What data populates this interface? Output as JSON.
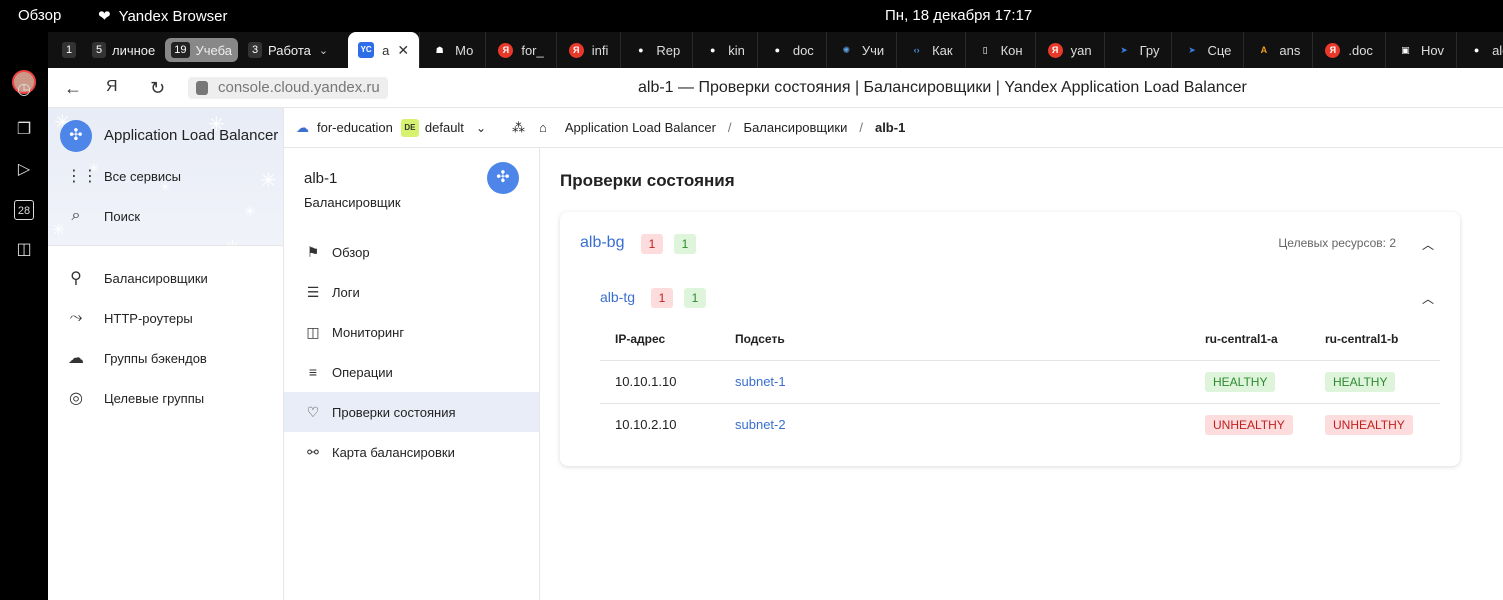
{
  "os_bar": {
    "overview": "Обзор",
    "browser_name": "Yandex Browser",
    "clock": "Пн, 18 декабря  17:17"
  },
  "dock": {
    "calendar_day": "28"
  },
  "tab_groups": [
    {
      "count": "1",
      "label": ""
    },
    {
      "count": "5",
      "label": "личное"
    },
    {
      "count": "19",
      "label": "Учеба"
    },
    {
      "count": "3",
      "label": "Работа"
    }
  ],
  "active_tab": {
    "favicon": "YC",
    "label": "a"
  },
  "tabs": [
    {
      "label": "Мо",
      "icon": "bot-icon",
      "color": "#ffffff"
    },
    {
      "label": "for_",
      "icon": "yandex-icon",
      "color": "#e8392b"
    },
    {
      "label": "infi",
      "icon": "yandex-icon",
      "color": "#e8392b"
    },
    {
      "label": "Rep",
      "icon": "github-icon",
      "color": "#ffffff"
    },
    {
      "label": "kin",
      "icon": "github-icon",
      "color": "#ffffff"
    },
    {
      "label": "doc",
      "icon": "github-icon",
      "color": "#ffffff"
    },
    {
      "label": "Учи",
      "icon": "spark-icon",
      "color": "#5aa0e0"
    },
    {
      "label": "Как",
      "icon": "code-icon",
      "color": "#4a90e2"
    },
    {
      "label": "Кон",
      "icon": "doc-icon",
      "color": "#ffffff"
    },
    {
      "label": "yan",
      "icon": "yandex-icon",
      "color": "#e8392b"
    },
    {
      "label": "Гру",
      "icon": "compass-icon",
      "color": "#3a7be8"
    },
    {
      "label": "Сце",
      "icon": "compass-icon",
      "color": "#3a7be8"
    },
    {
      "label": "ans",
      "icon": "a-icon",
      "color": "#f0a020"
    },
    {
      "label": ".doc",
      "icon": "yandex-icon",
      "color": "#e8392b"
    },
    {
      "label": "Hov",
      "icon": "book-icon",
      "color": "#ffffff"
    },
    {
      "label": "alex",
      "icon": "github-icon",
      "color": "#ffffff"
    }
  ],
  "address": {
    "url": "console.cloud.yandex.ru",
    "title": "alb-1 — Проверки состояния | Балансировщики | Yandex Application Load Balancer"
  },
  "sidebar": {
    "service": "Application Load Balancer",
    "all_services": "Все сервисы",
    "search": "Поиск",
    "items": [
      {
        "label": "Балансировщики",
        "icon": "balancer-icon"
      },
      {
        "label": "HTTP-роутеры",
        "icon": "router-icon"
      },
      {
        "label": "Группы бэкендов",
        "icon": "backend-groups-icon"
      },
      {
        "label": "Целевые группы",
        "icon": "target-groups-icon"
      }
    ]
  },
  "breadcrumbs": {
    "cloud": "for-education",
    "folder_badge": "DE",
    "folder": "default",
    "service": "Application Load Balancer",
    "section": "Балансировщики",
    "current": "alb-1"
  },
  "resource": {
    "name": "alb-1",
    "type": "Балансировщик"
  },
  "subnav": [
    {
      "label": "Обзор",
      "icon": "flag-icon"
    },
    {
      "label": "Логи",
      "icon": "logs-icon"
    },
    {
      "label": "Мониторинг",
      "icon": "monitoring-icon"
    },
    {
      "label": "Операции",
      "icon": "operations-icon"
    },
    {
      "label": "Проверки состояния",
      "icon": "heart-pulse-icon",
      "active": true
    },
    {
      "label": "Карта балансировки",
      "icon": "map-icon"
    }
  ],
  "main": {
    "title": "Проверки состояния",
    "backend_group": {
      "name": "alb-bg",
      "unhealthy": "1",
      "healthy": "1",
      "targets": "Целевых ресурсов: 2"
    },
    "target_group": {
      "name": "alb-tg",
      "unhealthy": "1",
      "healthy": "1"
    },
    "columns": [
      "IP-адрес",
      "Подсеть",
      "ru-central1-a",
      "ru-central1-b"
    ],
    "rows": [
      {
        "ip": "10.10.1.10",
        "subnet": "subnet-1",
        "zone_a": "HEALTHY",
        "zone_b": "HEALTHY"
      },
      {
        "ip": "10.10.2.10",
        "subnet": "subnet-2",
        "zone_a": "UNHEALTHY",
        "zone_b": "UNHEALTHY"
      }
    ]
  }
}
